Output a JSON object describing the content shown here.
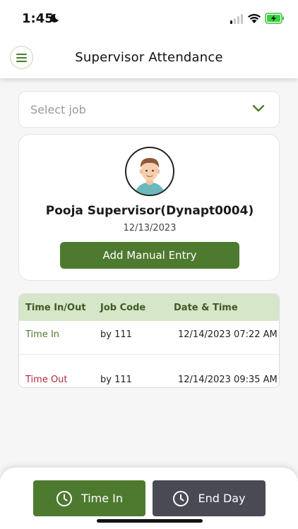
{
  "status_bar": {
    "time": "1:45",
    "icons": [
      "moon-icon",
      "signal-icon",
      "wifi-icon",
      "battery-charging-icon"
    ]
  },
  "header": {
    "title": "Supervisor Attendance",
    "menu_icon": "hamburger-menu-icon"
  },
  "job_select": {
    "placeholder": "Select job",
    "icon": "chevron-down-icon"
  },
  "profile": {
    "name": "Pooja Supervisor(Dynapt0004)",
    "date": "12/13/2023",
    "manual_entry_label": "Add Manual Entry"
  },
  "table": {
    "headers": [
      "Time In/Out",
      "Job Code",
      "Date & Time"
    ],
    "rows": [
      {
        "type": "Time In",
        "job_code": "by 111",
        "datetime": "12/14/2023 07:22 AM"
      },
      {
        "type": "Time Out",
        "job_code": "by 111",
        "datetime": "12/14/2023 09:35 AM"
      }
    ]
  },
  "actions": {
    "time_in_label": "Time In",
    "end_day_label": "End Day",
    "icon": "clock-icon"
  },
  "colors": {
    "primary_green": "#4e7a30",
    "header_green": "#d6e6c9",
    "time_out_red": "#b22c3f",
    "end_day_gray": "#4a4a55"
  }
}
